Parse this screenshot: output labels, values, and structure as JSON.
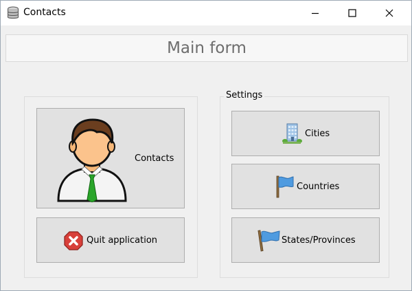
{
  "window": {
    "title": "Contacts"
  },
  "header": {
    "title": "Main form"
  },
  "left_panel": {
    "contacts_button": "Contacts",
    "quit_button": "Quit application"
  },
  "settings": {
    "legend": "Settings",
    "cities_button": "Cities",
    "countries_button": "Countries",
    "states_button": "States/Provinces"
  },
  "icons": {
    "app": "database-icon",
    "contacts": "person-icon",
    "quit": "close-circle-icon",
    "cities": "building-icon",
    "countries": "flag-icon",
    "states": "flag-icon"
  }
}
